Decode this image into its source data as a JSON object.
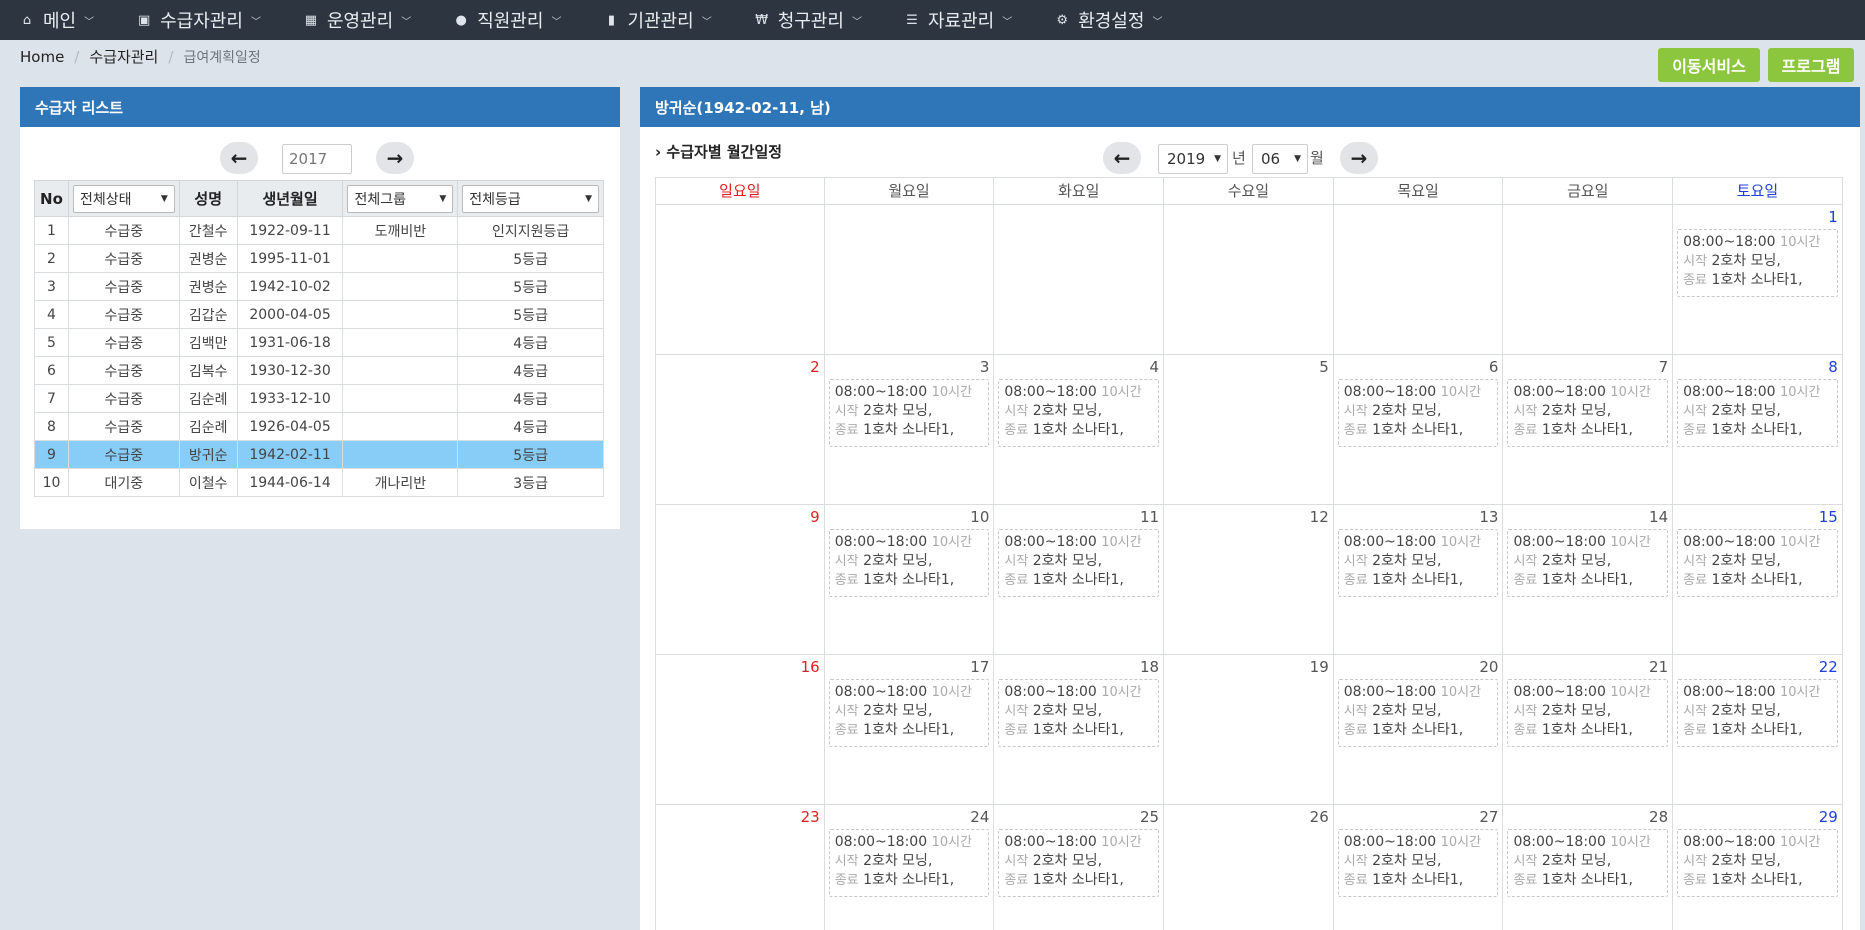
{
  "nav": {
    "items": [
      {
        "label": "메인",
        "icon": "home-icon",
        "glyph": "⌂"
      },
      {
        "label": "수급자관리",
        "icon": "id-card-icon",
        "glyph": "▣"
      },
      {
        "label": "운영관리",
        "icon": "calendar-icon",
        "glyph": "▦"
      },
      {
        "label": "직원관리",
        "icon": "users-icon",
        "glyph": "●"
      },
      {
        "label": "기관관리",
        "icon": "building-icon",
        "glyph": "▮"
      },
      {
        "label": "청구관리",
        "icon": "won-icon",
        "glyph": "₩"
      },
      {
        "label": "자료관리",
        "icon": "list-icon",
        "glyph": "☰"
      },
      {
        "label": "환경설정",
        "icon": "gear-icon",
        "glyph": "⚙"
      }
    ]
  },
  "breadcrumb": {
    "home": "Home",
    "section": "수급자관리",
    "current": "급여계획일정"
  },
  "actions": {
    "mobility": "이동서비스",
    "program": "프로그램"
  },
  "left_panel": {
    "title": "수급자 리스트",
    "year": "2017",
    "columns": {
      "no": "No",
      "status_filter": "전체상태",
      "name": "성명",
      "birth": "생년월일",
      "group_filter": "전체그룹",
      "grade_filter": "전체등급"
    },
    "rows": [
      {
        "no": "1",
        "status": "수급중",
        "name": "간철수",
        "birth": "1922-09-11",
        "group": "도깨비반",
        "grade": "인지지원등급"
      },
      {
        "no": "2",
        "status": "수급중",
        "name": "권병순",
        "birth": "1995-11-01",
        "group": "",
        "grade": "5등급"
      },
      {
        "no": "3",
        "status": "수급중",
        "name": "권병순",
        "birth": "1942-10-02",
        "group": "",
        "grade": "5등급"
      },
      {
        "no": "4",
        "status": "수급중",
        "name": "김갑순",
        "birth": "2000-04-05",
        "group": "",
        "grade": "5등급"
      },
      {
        "no": "5",
        "status": "수급중",
        "name": "김백만",
        "birth": "1931-06-18",
        "group": "",
        "grade": "4등급"
      },
      {
        "no": "6",
        "status": "수급중",
        "name": "김복수",
        "birth": "1930-12-30",
        "group": "",
        "grade": "4등급"
      },
      {
        "no": "7",
        "status": "수급중",
        "name": "김순례",
        "birth": "1933-12-10",
        "group": "",
        "grade": "4등급"
      },
      {
        "no": "8",
        "status": "수급중",
        "name": "김순례",
        "birth": "1926-04-05",
        "group": "",
        "grade": "4등급"
      },
      {
        "no": "9",
        "status": "수급중",
        "name": "방귀순",
        "birth": "1942-02-11",
        "group": "",
        "grade": "5등급"
      },
      {
        "no": "10",
        "status": "대기중",
        "name": "이철수",
        "birth": "1944-06-14",
        "group": "개나리반",
        "grade": "3등급"
      }
    ],
    "selected_row": 9
  },
  "right_panel": {
    "title": "방귀순(1942-02-11, 남)",
    "subtitle": "수급자별 월간일정",
    "year": "2019",
    "year_unit": "년",
    "month": "06",
    "month_unit": "월",
    "weekdays": [
      "일요일",
      "월요일",
      "화요일",
      "수요일",
      "목요일",
      "금요일",
      "토요일"
    ],
    "event": {
      "time": "08:00~18:00",
      "duration": "10시간",
      "start_label": "시작",
      "start_value": "2호차 모닝,",
      "end_label": "종료",
      "end_value": "1호차 소나타1,"
    },
    "weeks": [
      [
        null,
        null,
        null,
        null,
        null,
        null,
        {
          "day": "1",
          "event": true
        }
      ],
      [
        {
          "day": "2",
          "event": false
        },
        {
          "day": "3",
          "event": true
        },
        {
          "day": "4",
          "event": true
        },
        {
          "day": "5",
          "event": false
        },
        {
          "day": "6",
          "event": true
        },
        {
          "day": "7",
          "event": true
        },
        {
          "day": "8",
          "event": true
        }
      ],
      [
        {
          "day": "9",
          "event": false
        },
        {
          "day": "10",
          "event": true
        },
        {
          "day": "11",
          "event": true
        },
        {
          "day": "12",
          "event": false
        },
        {
          "day": "13",
          "event": true
        },
        {
          "day": "14",
          "event": true
        },
        {
          "day": "15",
          "event": true
        }
      ],
      [
        {
          "day": "16",
          "event": false
        },
        {
          "day": "17",
          "event": true
        },
        {
          "day": "18",
          "event": true
        },
        {
          "day": "19",
          "event": false
        },
        {
          "day": "20",
          "event": true
        },
        {
          "day": "21",
          "event": true
        },
        {
          "day": "22",
          "event": true
        }
      ],
      [
        {
          "day": "23",
          "event": false
        },
        {
          "day": "24",
          "event": true
        },
        {
          "day": "25",
          "event": true
        },
        {
          "day": "26",
          "event": false
        },
        {
          "day": "27",
          "event": true
        },
        {
          "day": "28",
          "event": true
        },
        {
          "day": "29",
          "event": true
        }
      ]
    ]
  },
  "colors": {
    "accent": "#2f76b8",
    "action": "#8cc63f",
    "selected": "#87cdf7",
    "sunday": "#e02020",
    "saturday": "#1e3fd8"
  }
}
